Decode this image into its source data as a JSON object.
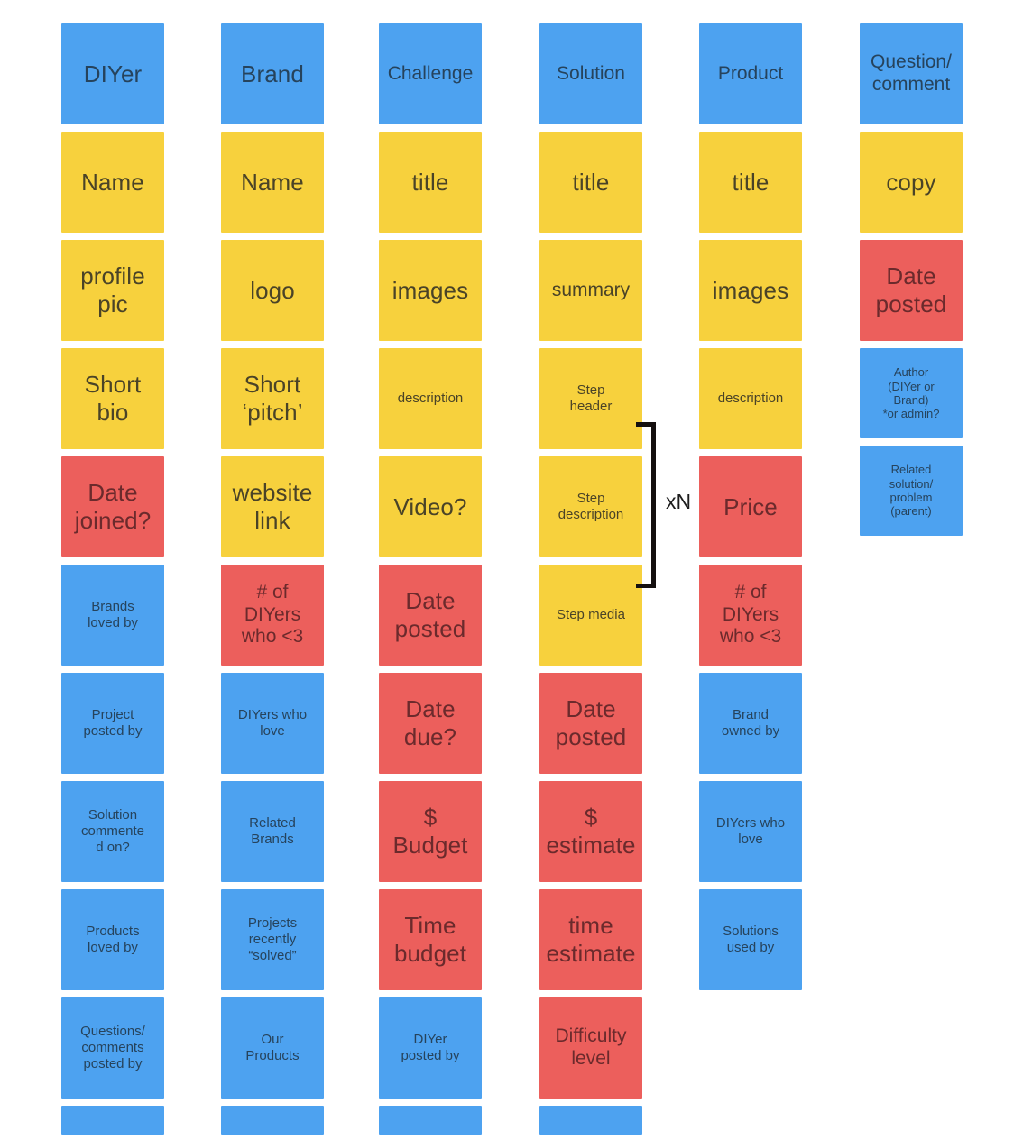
{
  "diagram": {
    "title": "Content model columns",
    "colors": {
      "blue": "#4da2f0",
      "yellow": "#f7d13d",
      "red": "#ec5f5c",
      "background": "#ffffff",
      "bracket": "#14100f"
    },
    "annotation": {
      "repeat_label": "xN"
    },
    "columns": [
      {
        "id": "diyer",
        "header": "DIYer",
        "cards": [
          {
            "label": "DIYer",
            "color": "blue",
            "size": "lg"
          },
          {
            "label": "Name",
            "color": "yellow",
            "size": "lg"
          },
          {
            "label": "profile\npic",
            "color": "yellow",
            "size": "lg"
          },
          {
            "label": "Short\nbio",
            "color": "yellow",
            "size": "lg"
          },
          {
            "label": "Date\njoined?",
            "color": "red",
            "size": "lg"
          },
          {
            "label": "Brands\nloved by",
            "color": "blue",
            "size": "sm"
          },
          {
            "label": "Project\nposted by",
            "color": "blue",
            "size": "sm"
          },
          {
            "label": "Solution\ncommente\nd on?",
            "color": "blue",
            "size": "sm"
          },
          {
            "label": "Products\nloved by",
            "color": "blue",
            "size": "sm"
          },
          {
            "label": "Questions/\ncomments\nposted by",
            "color": "blue",
            "size": "sm"
          },
          {
            "label": "",
            "color": "blue",
            "size": "sm",
            "cut": true
          }
        ]
      },
      {
        "id": "brand",
        "header": "Brand",
        "cards": [
          {
            "label": "Brand",
            "color": "blue",
            "size": "lg"
          },
          {
            "label": "Name",
            "color": "yellow",
            "size": "lg"
          },
          {
            "label": "logo",
            "color": "yellow",
            "size": "lg"
          },
          {
            "label": "Short\n‘pitch’",
            "color": "yellow",
            "size": "lg"
          },
          {
            "label": "website\nlink",
            "color": "yellow",
            "size": "lg"
          },
          {
            "label": "# of\nDIYers\nwho <3",
            "color": "red",
            "size": "md"
          },
          {
            "label": "DIYers who\nlove",
            "color": "blue",
            "size": "sm"
          },
          {
            "label": "Related\nBrands",
            "color": "blue",
            "size": "sm"
          },
          {
            "label": "Projects\nrecently\n“solved”",
            "color": "blue",
            "size": "sm"
          },
          {
            "label": "Our\nProducts",
            "color": "blue",
            "size": "sm"
          },
          {
            "label": "",
            "color": "blue",
            "size": "sm",
            "cut": true
          }
        ]
      },
      {
        "id": "challenge",
        "header": "Challenge",
        "cards": [
          {
            "label": "Challenge",
            "color": "blue",
            "size": "md"
          },
          {
            "label": "title",
            "color": "yellow",
            "size": "lg"
          },
          {
            "label": "images",
            "color": "yellow",
            "size": "lg"
          },
          {
            "label": "description",
            "color": "yellow",
            "size": "sm"
          },
          {
            "label": "Video?",
            "color": "yellow",
            "size": "lg"
          },
          {
            "label": "Date\nposted",
            "color": "red",
            "size": "lg"
          },
          {
            "label": "Date\ndue?",
            "color": "red",
            "size": "lg"
          },
          {
            "label": "$\nBudget",
            "color": "red",
            "size": "lg"
          },
          {
            "label": "Time\nbudget",
            "color": "red",
            "size": "lg"
          },
          {
            "label": "DIYer\nposted by",
            "color": "blue",
            "size": "sm"
          },
          {
            "label": "",
            "color": "blue",
            "size": "sm",
            "cut": true
          }
        ]
      },
      {
        "id": "solution",
        "header": "Solution",
        "cards": [
          {
            "label": "Solution",
            "color": "blue",
            "size": "md"
          },
          {
            "label": "title",
            "color": "yellow",
            "size": "lg"
          },
          {
            "label": "summary",
            "color": "yellow",
            "size": "md"
          },
          {
            "label": "Step\nheader",
            "color": "yellow",
            "size": "sm"
          },
          {
            "label": "Step\ndescription",
            "color": "yellow",
            "size": "sm"
          },
          {
            "label": "Step media",
            "color": "yellow",
            "size": "sm"
          },
          {
            "label": "Date\nposted",
            "color": "red",
            "size": "lg"
          },
          {
            "label": "$\nestimate",
            "color": "red",
            "size": "lg"
          },
          {
            "label": "time\nestimate",
            "color": "red",
            "size": "lg"
          },
          {
            "label": "Difficulty\nlevel",
            "color": "red",
            "size": "md"
          },
          {
            "label": "",
            "color": "blue",
            "size": "sm",
            "cut": true
          }
        ]
      },
      {
        "id": "product",
        "header": "Product",
        "cards": [
          {
            "label": "Product",
            "color": "blue",
            "size": "md"
          },
          {
            "label": "title",
            "color": "yellow",
            "size": "lg"
          },
          {
            "label": "images",
            "color": "yellow",
            "size": "lg"
          },
          {
            "label": "description",
            "color": "yellow",
            "size": "sm"
          },
          {
            "label": "Price",
            "color": "red",
            "size": "lg"
          },
          {
            "label": "# of\nDIYers\nwho <3",
            "color": "red",
            "size": "md"
          },
          {
            "label": "Brand\nowned by",
            "color": "blue",
            "size": "sm"
          },
          {
            "label": "DIYers who\nlove",
            "color": "blue",
            "size": "sm"
          },
          {
            "label": "Solutions\nused by",
            "color": "blue",
            "size": "sm"
          }
        ]
      },
      {
        "id": "question-comment",
        "header": "Question/comment",
        "cards": [
          {
            "label": "Question/\ncomment",
            "color": "blue",
            "size": "md"
          },
          {
            "label": "copy",
            "color": "yellow",
            "size": "lg"
          },
          {
            "label": "Date\nposted",
            "color": "red",
            "size": "lg"
          },
          {
            "label": "Author\n(DIYer or\nBrand)\n*or admin?",
            "color": "blue",
            "size": "xs",
            "short": true
          },
          {
            "label": "Related\nsolution/\nproblem\n(parent)",
            "color": "blue",
            "size": "xs",
            "short": true
          }
        ]
      }
    ]
  }
}
